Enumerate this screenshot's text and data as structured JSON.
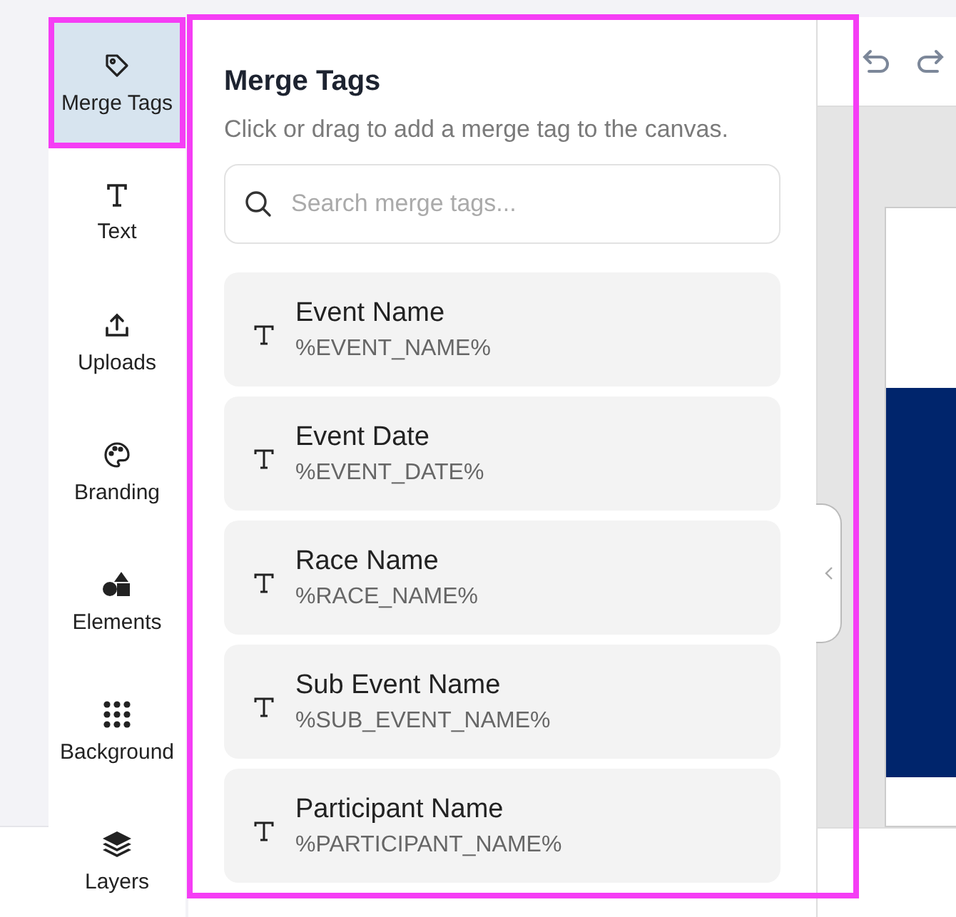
{
  "sidebar": {
    "items": [
      {
        "kind": "tag",
        "label": "Merge Tags",
        "selected": true
      },
      {
        "kind": "text",
        "label": "Text",
        "selected": false
      },
      {
        "kind": "upload",
        "label": "Uploads",
        "selected": false
      },
      {
        "kind": "palette",
        "label": "Branding",
        "selected": false
      },
      {
        "kind": "shapes",
        "label": "Elements",
        "selected": false
      },
      {
        "kind": "dots",
        "label": "Background",
        "selected": false
      },
      {
        "kind": "layers",
        "label": "Layers",
        "selected": false
      }
    ]
  },
  "panel": {
    "title": "Merge Tags",
    "subtitle": "Click or drag to add a merge tag to the canvas.",
    "search": {
      "placeholder": "Search merge tags..."
    },
    "tags": [
      {
        "name": "Event Name",
        "code": "%EVENT_NAME%"
      },
      {
        "name": "Event Date",
        "code": "%EVENT_DATE%"
      },
      {
        "name": "Race Name",
        "code": "%RACE_NAME%"
      },
      {
        "name": "Sub Event Name",
        "code": "%SUB_EVENT_NAME%"
      },
      {
        "name": "Participant Name",
        "code": "%PARTICIPANT_NAME%"
      }
    ]
  }
}
